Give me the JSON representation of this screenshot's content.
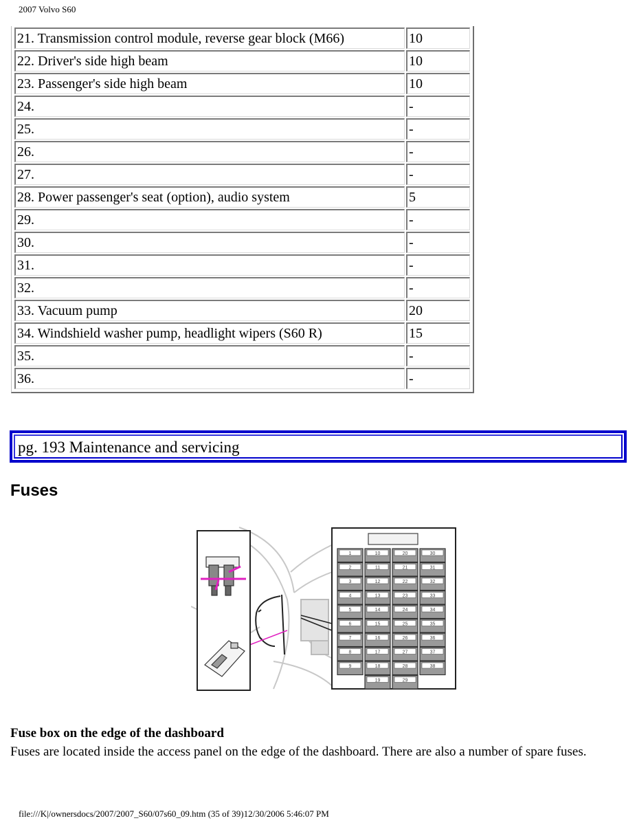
{
  "header": {
    "title": "2007 Volvo S60"
  },
  "fuse_table": {
    "rows": [
      {
        "desc": "21. Transmission control module, reverse gear block (M66)",
        "amp": "10"
      },
      {
        "desc": "22. Driver's side high beam",
        "amp": "10"
      },
      {
        "desc": "23. Passenger's side high beam",
        "amp": "10"
      },
      {
        "desc": "24.",
        "amp": "-"
      },
      {
        "desc": "25.",
        "amp": "-"
      },
      {
        "desc": "26.",
        "amp": "-"
      },
      {
        "desc": "27.",
        "amp": "-"
      },
      {
        "desc": "28. Power passenger's seat (option), audio system",
        "amp": "5"
      },
      {
        "desc": "29.",
        "amp": "-"
      },
      {
        "desc": "30.",
        "amp": "-"
      },
      {
        "desc": "31.",
        "amp": "-"
      },
      {
        "desc": "32.",
        "amp": "-"
      },
      {
        "desc": "33. Vacuum pump",
        "amp": "20"
      },
      {
        "desc": "34. Windshield washer pump, headlight wipers (S60 R)",
        "amp": "15"
      },
      {
        "desc": "35.",
        "amp": "-"
      },
      {
        "desc": "36.",
        "amp": "-"
      }
    ]
  },
  "page_ref": {
    "label": "pg. 193 Maintenance and servicing",
    "border_color": "#0000cc"
  },
  "section": {
    "title": "Fuses"
  },
  "figure": {
    "fuse_grid_columns": [
      [
        "1",
        "2",
        "3",
        "4",
        "5",
        "6",
        "7",
        "8",
        "9"
      ],
      [
        "10",
        "11",
        "12",
        "13",
        "14",
        "15",
        "16",
        "17",
        "18",
        "19"
      ],
      [
        "20",
        "21",
        "22",
        "23",
        "24",
        "25",
        "26",
        "27",
        "28",
        "29"
      ],
      [
        "30",
        "31",
        "32",
        "33",
        "34",
        "35",
        "36",
        "37",
        "38"
      ]
    ],
    "highlight_color": "#e020c0"
  },
  "caption": {
    "title": "Fuse box on the edge of the dashboard",
    "body": "Fuses are located inside the access panel on the edge of the dashboard. There are also a number of spare fuses."
  },
  "footer": {
    "text": "file:///K|/ownersdocs/2007/2007_S60/07s60_09.htm (35 of 39)12/30/2006 5:46:07 PM"
  }
}
